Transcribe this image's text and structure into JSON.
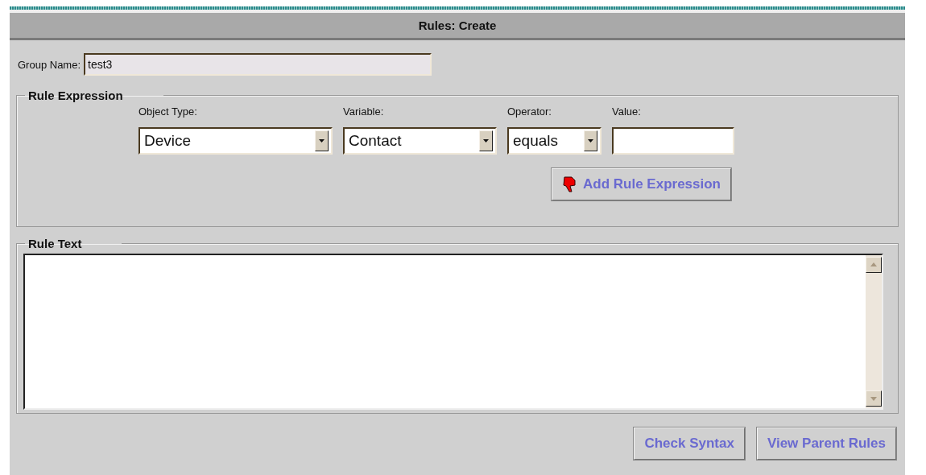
{
  "header": {
    "title": "Rules: Create"
  },
  "group_name": {
    "label": "Group Name:",
    "value": "test3"
  },
  "rule_expression": {
    "title": "Rule Expression",
    "fields": [
      {
        "kind": "dropdown",
        "label": "Object Type:",
        "value": "Device"
      },
      {
        "kind": "dropdown",
        "label": "Variable:",
        "value": "Contact"
      },
      {
        "kind": "dropdown",
        "label": "Operator:",
        "value": "equals"
      },
      {
        "kind": "text",
        "label": "Value:"
      }
    ],
    "add_button": "Add Rule Expression"
  },
  "rule_text": {
    "title": "Rule Text"
  },
  "buttons": [
    "Check Syntax",
    "View Parent Rules"
  ]
}
